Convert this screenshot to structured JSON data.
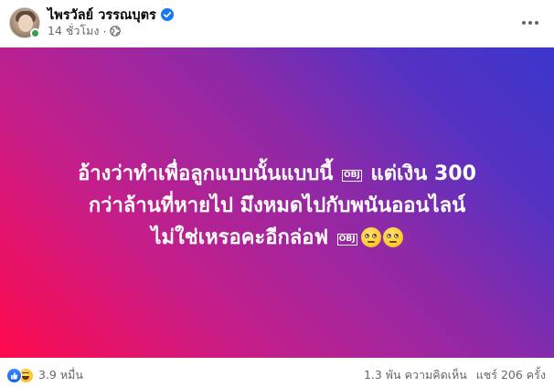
{
  "author": {
    "name": "ไพรวัลย์ วรรณบุตร",
    "verified": true,
    "time": "14 ชั่วโมง",
    "meta_separator": "·",
    "privacy_icon": "globe-icon"
  },
  "post": {
    "lines": [
      {
        "before": "อ้างว่าทำเพื่อลูกแบบนั้นแบบนี้",
        "obj": "OBJ",
        "after": "แต่เงิน 300"
      },
      {
        "text": "กว่าล้านที่หายไป มึงหมดไปกับพนันออนไลน์"
      },
      {
        "before": "ไม่ใช่เหรอคะอีกล่อฟ",
        "obj": "OBJ"
      }
    ],
    "emojis": [
      "face-with-rolling-eyes-emoji",
      "face-with-rolling-eyes-emoji"
    ],
    "background": {
      "gradient_start": "#ff0a4c",
      "gradient_end": "#3b36cc"
    }
  },
  "footer": {
    "reaction_count": "3.9 หมื่น",
    "reaction_icons": [
      "like-icon",
      "haha-icon"
    ],
    "comments": "1.3 พัน ความคิดเห็น",
    "shares": "แชร์ 206 ครั้ง"
  },
  "colors": {
    "accent": "#1877f2",
    "secondary_text": "#65676b",
    "online": "#31a24c"
  }
}
